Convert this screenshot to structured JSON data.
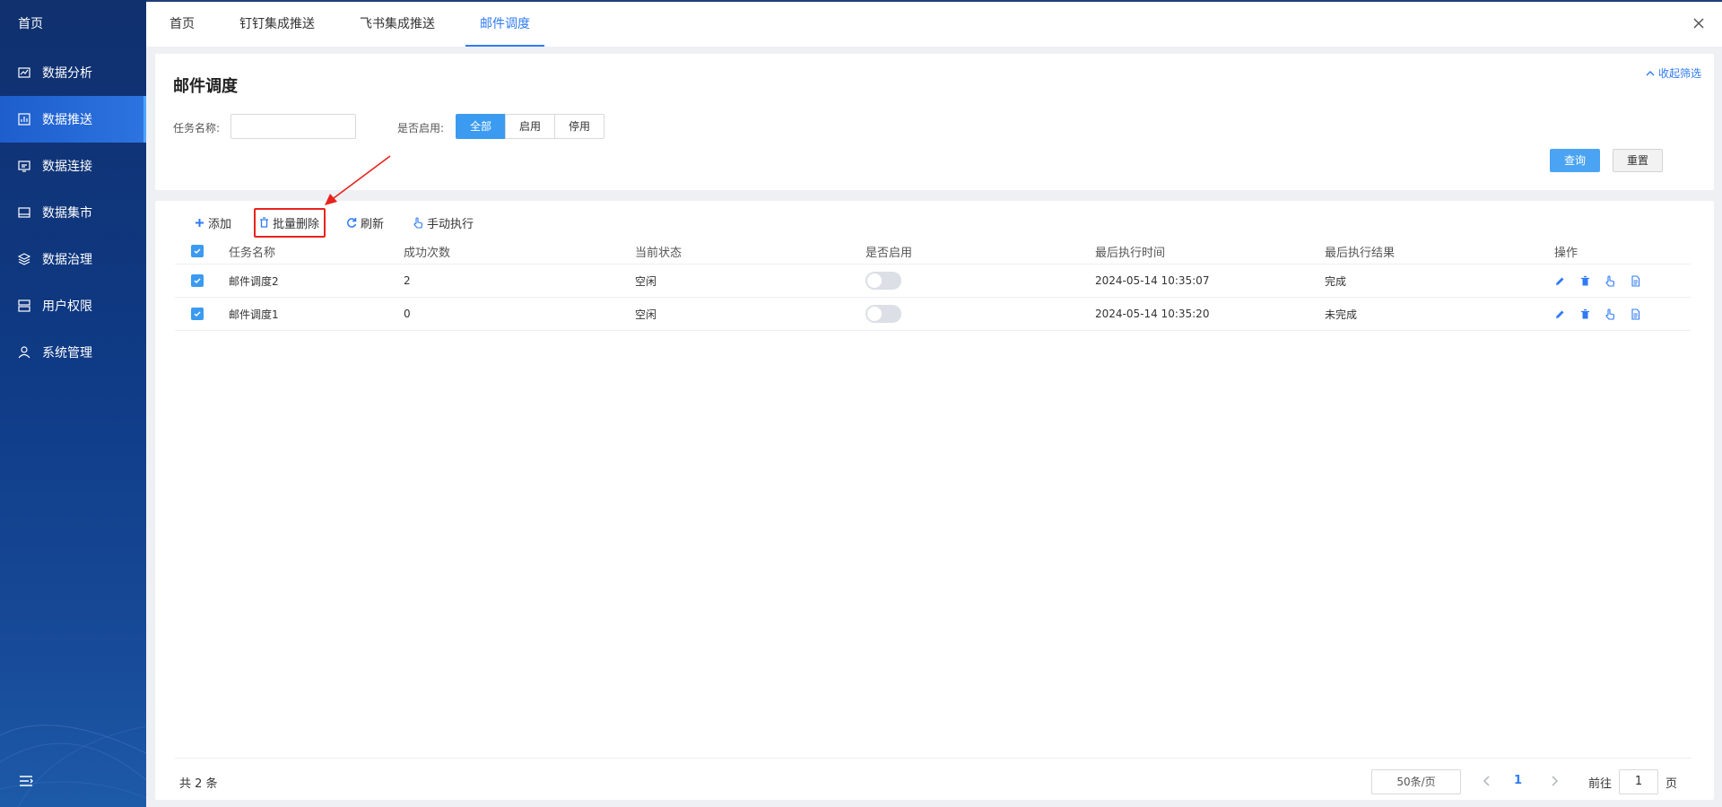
{
  "sidebar": {
    "home": "首页",
    "items": [
      {
        "label": "数据分析",
        "icon": "analysis-icon"
      },
      {
        "label": "数据推送",
        "icon": "push-icon",
        "active": true
      },
      {
        "label": "数据连接",
        "icon": "connect-icon"
      },
      {
        "label": "数据集市",
        "icon": "market-icon"
      },
      {
        "label": "数据治理",
        "icon": "layers-icon"
      },
      {
        "label": "用户权限",
        "icon": "user-icon"
      },
      {
        "label": "系统管理",
        "icon": "settings-icon"
      }
    ]
  },
  "tabs": [
    {
      "label": "首页"
    },
    {
      "label": "钉钉集成推送"
    },
    {
      "label": "飞书集成推送"
    },
    {
      "label": "邮件调度",
      "active": true
    }
  ],
  "filter": {
    "title": "邮件调度",
    "collapse_label": "收起筛选",
    "task_name_label": "任务名称:",
    "task_name_value": "",
    "enabled_label": "是否启用:",
    "enabled_options": [
      "全部",
      "启用",
      "停用"
    ],
    "enabled_selected": "全部",
    "query_label": "查询",
    "reset_label": "重置"
  },
  "toolbar": {
    "add": "添加",
    "batch_delete": "批量删除",
    "refresh": "刷新",
    "manual_run": "手动执行"
  },
  "table": {
    "columns": [
      "任务名称",
      "成功次数",
      "当前状态",
      "是否启用",
      "最后执行时间",
      "最后执行结果",
      "操作"
    ],
    "rows": [
      {
        "name": "邮件调度2",
        "success_count": "2",
        "status": "空闲",
        "enabled": false,
        "last_time": "2024-05-14 10:35:07",
        "last_result": "完成",
        "checked": true
      },
      {
        "name": "邮件调度1",
        "success_count": "0",
        "status": "空闲",
        "enabled": false,
        "last_time": "2024-05-14 10:35:20",
        "last_result": "未完成",
        "checked": true
      }
    ]
  },
  "pagination": {
    "total": "共 2 条",
    "page_size": "50条/页",
    "current": "1",
    "goto_label": "前往",
    "goto_value": "1",
    "page_suffix": "页"
  },
  "colors": {
    "accent": "#2f7bf5",
    "sidebar": "#10306e",
    "highlight": "#e8231c"
  }
}
